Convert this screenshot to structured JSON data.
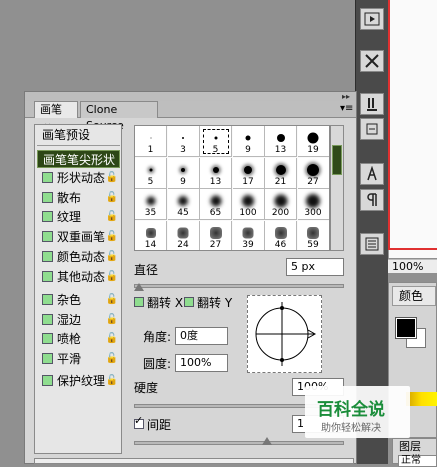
{
  "panel": {
    "tabs": [
      "画笔",
      "Clone Source"
    ],
    "presets_label": "画笔预设"
  },
  "list": {
    "items": [
      {
        "label": "画笔笔尖形状",
        "selected": true,
        "checkbox": false,
        "lock": false
      },
      {
        "label": "形状动态",
        "checkbox": true,
        "lock": true
      },
      {
        "label": "散布",
        "checkbox": true,
        "lock": true
      },
      {
        "label": "纹理",
        "checkbox": true,
        "lock": true
      },
      {
        "label": "双重画笔",
        "checkbox": true,
        "lock": true
      },
      {
        "label": "颜色动态",
        "checkbox": true,
        "lock": true
      },
      {
        "label": "其他动态",
        "checkbox": true,
        "lock": true
      },
      {
        "label": "杂色",
        "checkbox": true,
        "lock": true
      },
      {
        "label": "湿边",
        "checkbox": true,
        "lock": true
      },
      {
        "label": "喷枪",
        "checkbox": true,
        "lock": true
      },
      {
        "label": "平滑",
        "checkbox": true,
        "lock": true
      },
      {
        "label": "保护纹理",
        "checkbox": true,
        "lock": true
      }
    ]
  },
  "brushes": {
    "rows": [
      [
        "1",
        "3",
        "5",
        "9",
        "13",
        "19"
      ],
      [
        "5",
        "9",
        "13",
        "17",
        "21",
        "27"
      ],
      [
        "35",
        "45",
        "65",
        "100",
        "200",
        "300"
      ],
      [
        "14",
        "24",
        "27",
        "39",
        "46",
        "59"
      ]
    ],
    "selected": "5"
  },
  "controls": {
    "diameter_label": "直径",
    "diameter_value": "5 px",
    "flip_x_label": "翻转 X",
    "flip_y_label": "翻转 Y",
    "angle_label": "角度:",
    "angle_value": "0度",
    "roundness_label": "圆度:",
    "roundness_value": "100%",
    "hardness_label": "硬度",
    "hardness_value": "100%",
    "spacing_label": "间距",
    "spacing_value": "1"
  },
  "right": {
    "zoom": "100%",
    "color_tab": "颜色",
    "layers_tab": "图层",
    "blend_mode": "正常"
  },
  "watermark": {
    "title": "百科全说",
    "subtitle": "助你轻松解决"
  }
}
